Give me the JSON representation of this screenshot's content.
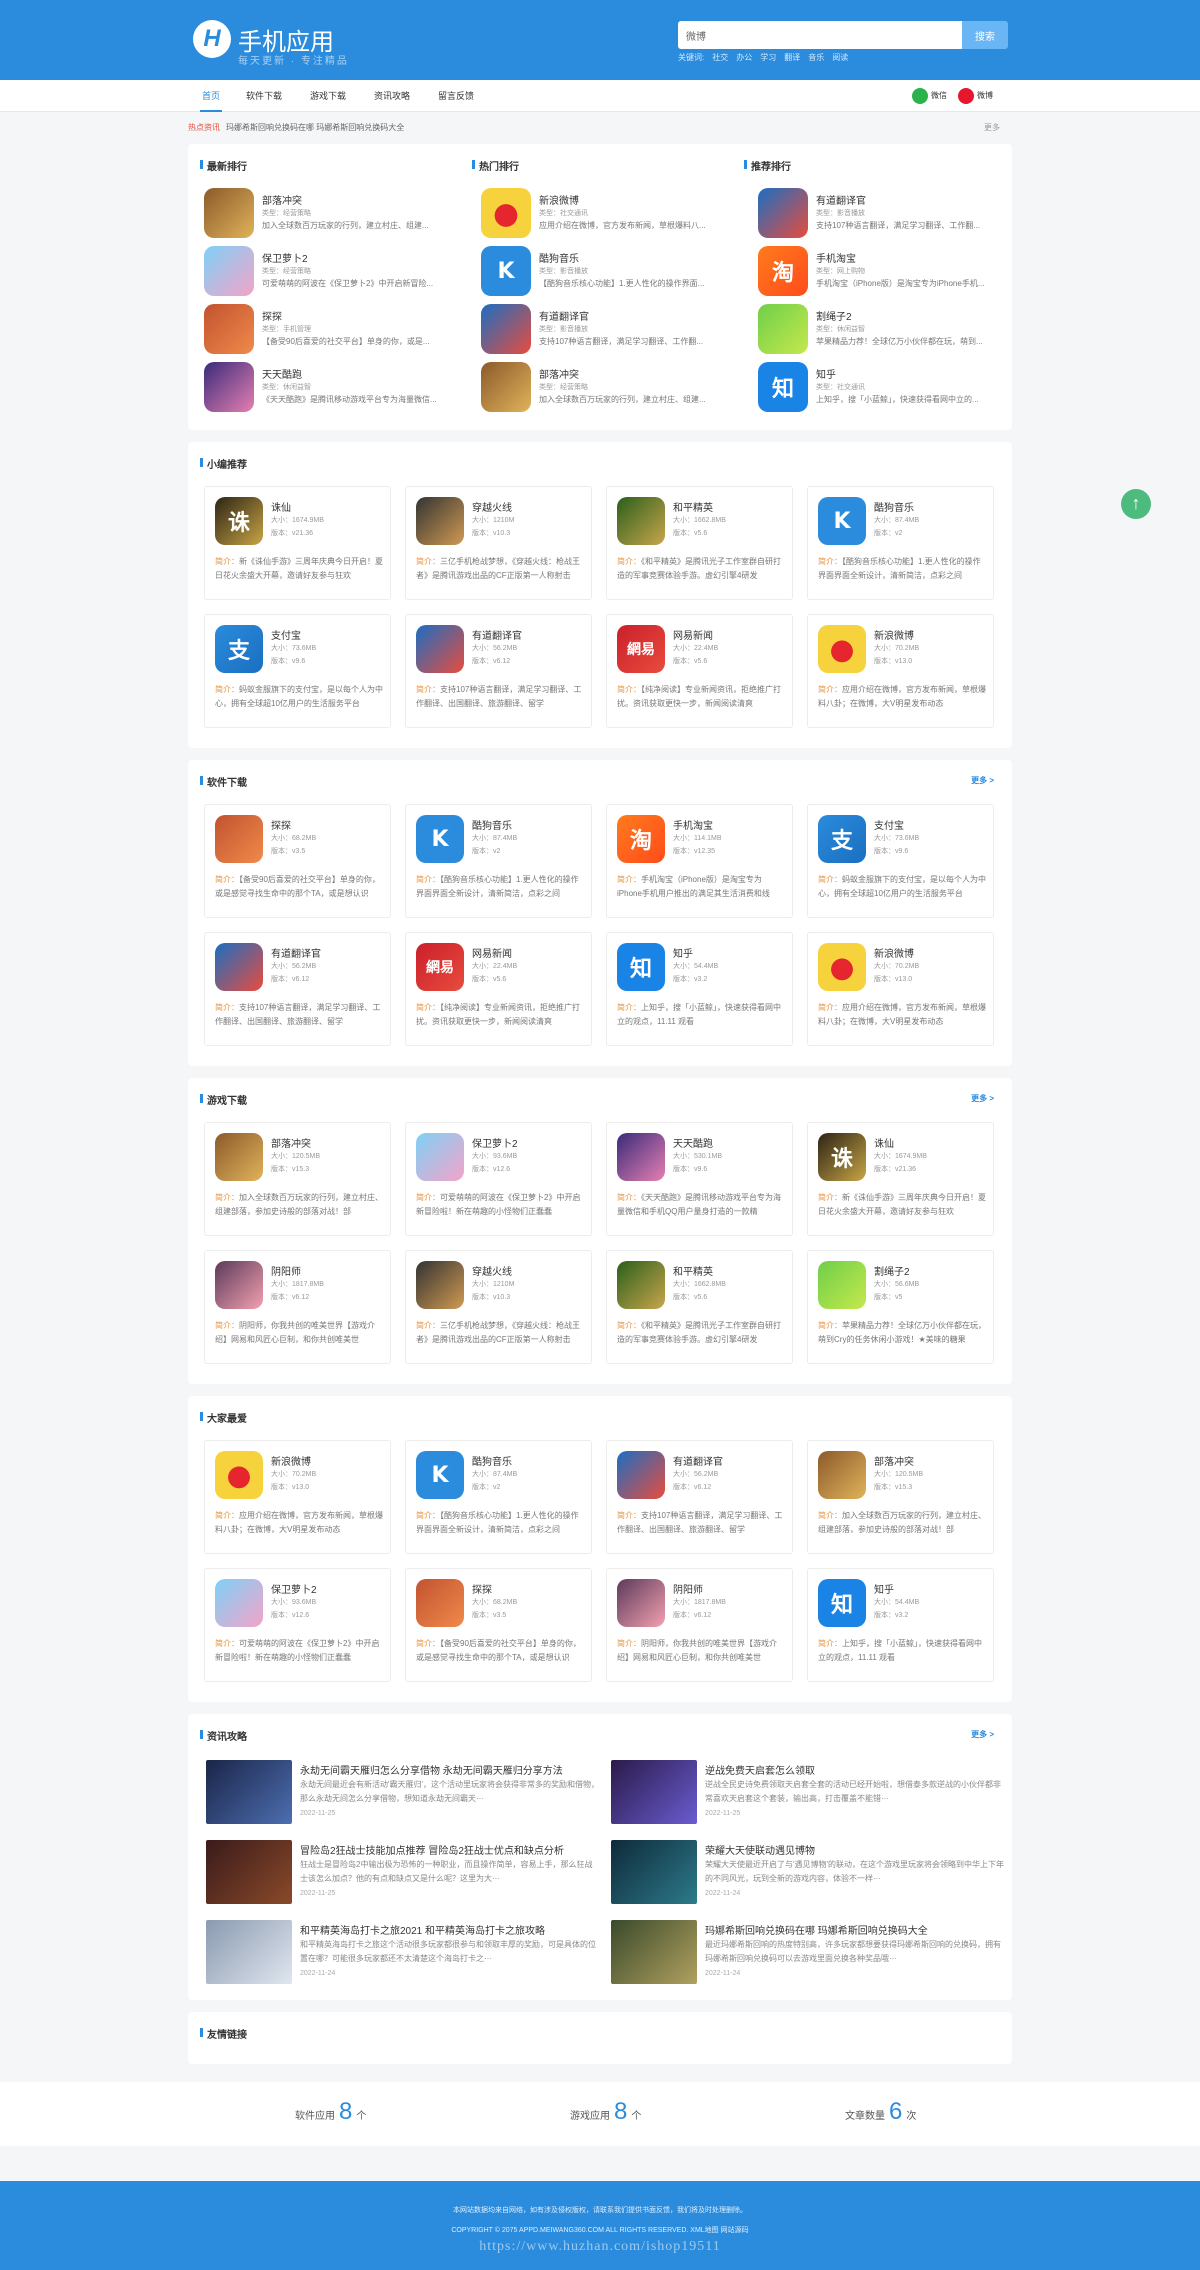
{
  "header": {
    "brand": "手机应用",
    "slogan": "每天更新 · 专注精品",
    "logo_letter": "H",
    "search_value": "微博",
    "search_button": "搜索",
    "keywords_label": "关键词:",
    "keywords": [
      "社交",
      "办公",
      "学习",
      "翻译",
      "音乐",
      "阅读"
    ]
  },
  "nav": {
    "items": [
      "首页",
      "软件下载",
      "游戏下载",
      "资讯攻略",
      "留言反馈"
    ],
    "wechat": "微信",
    "weibo": "微博"
  },
  "hot": {
    "label": "热点资讯",
    "text": "玛娜希斯回响兑换码在哪 玛娜希斯回响兑换码大全",
    "more": "更多"
  },
  "ranks": [
    {
      "title": "最新排行",
      "items": [
        {
          "name": "部落冲突",
          "type": "类型：",
          "type_val": "经营策略",
          "desc": "加入全球数百万玩家的行列，建立村庄、组建..."
        },
        {
          "name": "保卫萝卜2",
          "type": "类型：",
          "type_val": "经营策略",
          "desc": "可爱萌萌的阿波在《保卫萝卜2》中开启新冒险..."
        },
        {
          "name": "探探",
          "type": "类型：",
          "type_val": "手机管理",
          "desc": "【备受90后喜爱的社交平台】单身的你，或是..."
        },
        {
          "name": "天天酷跑",
          "type": "类型：",
          "type_val": "休闲益智",
          "desc": "《天天酷跑》是腾讯移动游戏平台专为海量微信..."
        }
      ]
    },
    {
      "title": "热门排行",
      "items": [
        {
          "name": "新浪微博",
          "type": "类型：",
          "type_val": "社交通讯",
          "desc": "应用介绍在微博，官方发布新闻，草根爆料八..."
        },
        {
          "name": "酷狗音乐",
          "type": "类型：",
          "type_val": "影音播放",
          "desc": "【酷狗音乐核心功能】1.更人性化的操作界面..."
        },
        {
          "name": "有道翻译官",
          "type": "类型：",
          "type_val": "影音播放",
          "desc": "支持107种语言翻译，满足学习翻译、工作翻..."
        },
        {
          "name": "部落冲突",
          "type": "类型：",
          "type_val": "经营策略",
          "desc": "加入全球数百万玩家的行列，建立村庄、组建..."
        }
      ]
    },
    {
      "title": "推荐排行",
      "items": [
        {
          "name": "有道翻译官",
          "type": "类型：",
          "type_val": "影音播放",
          "desc": "支持107种语言翻译，满足学习翻译、工作翻..."
        },
        {
          "name": "手机淘宝",
          "type": "类型：",
          "type_val": "网上购物",
          "desc": "手机淘宝（iPhone版）是淘宝专为iPhone手机..."
        },
        {
          "name": "割绳子2",
          "type": "类型：",
          "type_val": "休闲益智",
          "desc": "苹果精品力荐！全球亿万小伙伴都在玩，萌到..."
        },
        {
          "name": "知乎",
          "type": "类型：",
          "type_val": "社交通讯",
          "desc": "上知乎，搜「小蓝鲸」，快速获得看网中立的..."
        }
      ]
    }
  ],
  "sections": [
    {
      "title": "小编推荐",
      "more": "",
      "cards": [
        {
          "name": "诛仙",
          "size": "大小：1674.9MB",
          "ver": "版本：v21.36",
          "desc": "新《诛仙手游》三周年庆典今日开启！夏日花火余盛大开幕，邀请好友参与狂欢"
        },
        {
          "name": "穿越火线",
          "size": "大小：1210M",
          "ver": "版本：v10.3",
          "desc": "三亿手机枪战梦想，《穿越火线：枪战王者》是腾讯游戏出品的CF正版第一人称射击"
        },
        {
          "name": "和平精英",
          "size": "大小：1662.8MB",
          "ver": "版本：v5.6",
          "desc": "《和平精英》是腾讯光子工作室群自研打造的军事竞赛体验手游。虚幻引擎4研发"
        },
        {
          "name": "酷狗音乐",
          "size": "大小：87.4MB",
          "ver": "版本：v2",
          "desc": "【酷狗音乐核心功能】1.更人性化的操作界面界面全新设计，清新简洁，点彩之间"
        },
        {
          "name": "支付宝",
          "size": "大小：73.6MB",
          "ver": "版本：v9.6",
          "desc": "蚂蚁金服旗下的支付宝，是以每个人为中心，拥有全球超10亿用户的生活服务平台"
        },
        {
          "name": "有道翻译官",
          "size": "大小：56.2MB",
          "ver": "版本：v6.12",
          "desc": "支持107种语言翻译，满足学习翻译、工作翻译、出国翻译、旅游翻译、留学"
        },
        {
          "name": "网易新闻",
          "size": "大小：22.4MB",
          "ver": "版本：v5.6",
          "desc": "【纯净阅读】专业新闻资讯，拒绝推广打扰。资讯获取更快一步，新闻阅读清爽"
        },
        {
          "name": "新浪微博",
          "size": "大小：70.2MB",
          "ver": "版本：v13.0",
          "desc": "应用介绍在微博，官方发布新闻，草根爆料八卦；在微博，大V明星发布动态"
        }
      ]
    },
    {
      "title": "软件下载",
      "more": "更多 >",
      "cards": [
        {
          "name": "探探",
          "size": "大小：68.2MB",
          "ver": "版本：v3.5",
          "desc": "【备受90后喜爱的社交平台】单身的你，或是感觉寻找生命中的那个TA，或是想认识"
        },
        {
          "name": "酷狗音乐",
          "size": "大小：87.4MB",
          "ver": "版本：v2",
          "desc": "【酷狗音乐核心功能】1.更人性化的操作界面界面全新设计，清新简洁，点彩之间"
        },
        {
          "name": "手机淘宝",
          "size": "大小：114.1MB",
          "ver": "版本：v12.35",
          "desc": "手机淘宝（iPhone版）是淘宝专为iPhone手机用户推出的满足其生活消费和线"
        },
        {
          "name": "支付宝",
          "size": "大小：73.6MB",
          "ver": "版本：v9.6",
          "desc": "蚂蚁金服旗下的支付宝，是以每个人为中心，拥有全球超10亿用户的生活服务平台"
        },
        {
          "name": "有道翻译官",
          "size": "大小：56.2MB",
          "ver": "版本：v6.12",
          "desc": "支持107种语言翻译，满足学习翻译、工作翻译、出国翻译、旅游翻译、留学"
        },
        {
          "name": "网易新闻",
          "size": "大小：22.4MB",
          "ver": "版本：v5.6",
          "desc": "【纯净阅读】专业新闻资讯，拒绝推广打扰。资讯获取更快一步，新闻阅读清爽"
        },
        {
          "name": "知乎",
          "size": "大小：54.4MB",
          "ver": "版本：v3.2",
          "desc": "上知乎，搜「小蓝鲸」，快速获得看网中立的观点，11.11 观看"
        },
        {
          "name": "新浪微博",
          "size": "大小：70.2MB",
          "ver": "版本：v13.0",
          "desc": "应用介绍在微博，官方发布新闻，草根爆料八卦；在微博，大V明星发布动态"
        }
      ]
    },
    {
      "title": "游戏下载",
      "more": "更多 >",
      "cards": [
        {
          "name": "部落冲突",
          "size": "大小：120.5MB",
          "ver": "版本：v15.3",
          "desc": "加入全球数百万玩家的行列，建立村庄、组建部落，参加史诗般的部落对战！部"
        },
        {
          "name": "保卫萝卜2",
          "size": "大小：93.6MB",
          "ver": "版本：v12.6",
          "desc": "可爱萌萌的阿波在《保卫萝卜2》中开启新冒险啦！新在萌趣的小怪物们正蠢蠢"
        },
        {
          "name": "天天酷跑",
          "size": "大小：530.1MB",
          "ver": "版本：v9.6",
          "desc": "《天天酷跑》是腾讯移动游戏平台专为海量微信和手机QQ用户量身打造的一款精"
        },
        {
          "name": "诛仙",
          "size": "大小：1674.9MB",
          "ver": "版本：v21.36",
          "desc": "新《诛仙手游》三周年庆典今日开启！夏日花火余盛大开幕，邀请好友参与狂欢"
        },
        {
          "name": "阴阳师",
          "size": "大小：1817.8MB",
          "ver": "版本：v6.12",
          "desc": "阴阳师，你我共创的唯美世界【游戏介绍】网易和风匠心巨制，和你共创唯美世"
        },
        {
          "name": "穿越火线",
          "size": "大小：1210M",
          "ver": "版本：v10.3",
          "desc": "三亿手机枪战梦想，《穿越火线：枪战王者》是腾讯游戏出品的CF正版第一人称射击"
        },
        {
          "name": "和平精英",
          "size": "大小：1662.8MB",
          "ver": "版本：v5.6",
          "desc": "《和平精英》是腾讯光子工作室群自研打造的军事竞赛体验手游。虚幻引擎4研发"
        },
        {
          "name": "割绳子2",
          "size": "大小：56.6MB",
          "ver": "版本：v5",
          "desc": "苹果精品力荐！全球亿万小伙伴都在玩，萌到Cry的任务休闲小游戏！★美味的糖果"
        }
      ]
    },
    {
      "title": "大家最爱",
      "more": "",
      "cards": [
        {
          "name": "新浪微博",
          "size": "大小：70.2MB",
          "ver": "版本：v13.0",
          "desc": "应用介绍在微博，官方发布新闻，草根爆料八卦；在微博，大V明星发布动态"
        },
        {
          "name": "酷狗音乐",
          "size": "大小：87.4MB",
          "ver": "版本：v2",
          "desc": "【酷狗音乐核心功能】1.更人性化的操作界面界面全新设计，清新简洁，点彩之间"
        },
        {
          "name": "有道翻译官",
          "size": "大小：56.2MB",
          "ver": "版本：v6.12",
          "desc": "支持107种语言翻译，满足学习翻译、工作翻译、出国翻译、旅游翻译、留学"
        },
        {
          "name": "部落冲突",
          "size": "大小：120.5MB",
          "ver": "版本：v15.3",
          "desc": "加入全球数百万玩家的行列，建立村庄、组建部落，参加史诗般的部落对战！部"
        },
        {
          "name": "保卫萝卜2",
          "size": "大小：93.6MB",
          "ver": "版本：v12.6",
          "desc": "可爱萌萌的阿波在《保卫萝卜2》中开启新冒险啦！新在萌趣的小怪物们正蠢蠢"
        },
        {
          "name": "探探",
          "size": "大小：68.2MB",
          "ver": "版本：v3.5",
          "desc": "【备受90后喜爱的社交平台】单身的你，或是感觉寻找生命中的那个TA，或是想认识"
        },
        {
          "name": "阴阳师",
          "size": "大小：1817.8MB",
          "ver": "版本：v6.12",
          "desc": "阴阳师，你我共创的唯美世界【游戏介绍】网易和风匠心巨制，和你共创唯美世"
        },
        {
          "name": "知乎",
          "size": "大小：54.4MB",
          "ver": "版本：v3.2",
          "desc": "上知乎，搜「小蓝鲸」，快速获得看网中立的观点，11.11 观看"
        }
      ]
    }
  ],
  "desc_label": "简介：",
  "news": {
    "title": "资讯攻略",
    "more": "更多 >",
    "items": [
      {
        "title": "永劫无间霸天雁归怎么分享借物 永劫无间霸天雁归分享方法",
        "desc": "永劫无间最近会有新活动'霸天雁归'，这个活动里玩家将会获得非常多的奖励和借物，那么永劫无间怎么分享借物，想知道永劫无间霸天···",
        "date": "2022-11-25"
      },
      {
        "title": "逆战免费天启套怎么领取",
        "desc": "逆战全民史诗免费领取天启套全套的活动已经开始啦，想借泰多款逆战的小伙伴都非常喜欢天启套这个套装，输出高，打击覆盖不能错···",
        "date": "2022-11-25"
      },
      {
        "title": "冒险岛2狂战士技能加点推荐 冒险岛2狂战士优点和缺点分析",
        "desc": "狂战士是冒险岛2中输出极为恐怖的一种职业，而且操作简单，容易上手，那么狂战士该怎么加点？他的有点和缺点又是什么呢？这里为大···",
        "date": "2022-11-25"
      },
      {
        "title": "荣耀大天使联动遇见博物",
        "desc": "荣耀大天使最近开启了与'遇见博物'的联动，在这个游戏里玩家将会领略到中华上下年的不同风光，玩到全新的游戏内容，体验不一样···",
        "date": "2022-11-24"
      },
      {
        "title": "和平精英海岛打卡之旅2021 和平精英海岛打卡之旅攻略",
        "desc": "和平精英海岛打卡之旅这个活动很多玩家都很参与和领取丰厚的奖励，可是具体的位置在哪？可能很多玩家都还不太清楚这个海岛打卡之···",
        "date": "2022-11-24"
      },
      {
        "title": "玛娜希斯回响兑换码在哪 玛娜希斯回响兑换码大全",
        "desc": "最近玛娜希斯回响的热度特别高，许多玩家都想要获得玛娜希斯回响的兑换码，拥有玛娜希斯回响兑换码可以去游戏里面兑换各种奖品哦···",
        "date": "2022-11-24"
      }
    ]
  },
  "links": {
    "title": "友情链接"
  },
  "stats": [
    {
      "label": "软件应用",
      "value": "8",
      "unit": "个"
    },
    {
      "label": "游戏应用",
      "value": "8",
      "unit": "个"
    },
    {
      "label": "文章数量",
      "value": "6",
      "unit": "次"
    }
  ],
  "footer": {
    "line1": "本网站数据均来自网络，如有涉及侵权版权，请联系我们提供书面反馈，我们将及时处理删除。",
    "line2": "COPYRIGHT © 2075 APPD.MEIWANG360.COM ALL RIGHTS RESERVED. XML地图 网站源码",
    "watermark": "https://www.huzhan.com/ishop19511"
  },
  "icons": {
    "brand_color": "#2b8bdc",
    "top_button": "arrow-up-icon"
  }
}
